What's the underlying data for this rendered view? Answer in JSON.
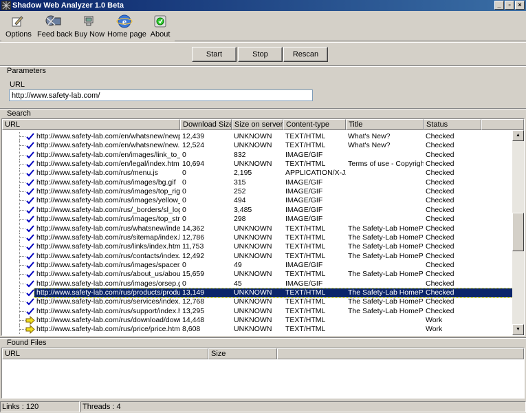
{
  "window": {
    "title": "Shadow Web Analyzer 1.0 Beta"
  },
  "toolbar": {
    "options": "Options",
    "feedback": "Feed back",
    "buynow": "Buy Now",
    "homepage": "Home page",
    "about": "About"
  },
  "actions": {
    "start": "Start",
    "stop": "Stop",
    "rescan": "Rescan"
  },
  "parameters": {
    "group_label": "Parameters",
    "url_label": "URL",
    "url_value": "http://www.safety-lab.com/"
  },
  "search": {
    "group_label": "Search",
    "columns": [
      "URL",
      "Download Size",
      "Size on server",
      "Content-type",
      "Title",
      "Status"
    ],
    "rows": [
      {
        "icon": "check",
        "url": "http://www.safety-lab.com/en/whatsnew/newpres...",
        "dl": "12,439",
        "srv": "UNKNOWN",
        "ct": "TEXT/HTML",
        "title": "What's New?",
        "status": "Checked"
      },
      {
        "icon": "check",
        "url": "http://www.safety-lab.com/en/whatsnew/new.htm",
        "dl": "12,524",
        "srv": "UNKNOWN",
        "ct": "TEXT/HTML",
        "title": "What's New?",
        "status": "Checked"
      },
      {
        "icon": "check",
        "url": "http://www.safety-lab.com/en/images/link_to_top....",
        "dl": "0",
        "srv": "832",
        "ct": "IMAGE/GIF",
        "title": "",
        "status": "Checked"
      },
      {
        "icon": "check",
        "url": "http://www.safety-lab.com/en/legal/index.htm",
        "dl": "10,694",
        "srv": "UNKNOWN",
        "ct": "TEXT/HTML",
        "title": "Terms of use - Copyright - ...",
        "status": "Checked"
      },
      {
        "icon": "check",
        "url": "http://www.safety-lab.com/rus/menu.js",
        "dl": "0",
        "srv": "2,195",
        "ct": "APPLICATION/X-JA...",
        "title": "",
        "status": "Checked"
      },
      {
        "icon": "check",
        "url": "http://www.safety-lab.com/rus/images/bg.gif",
        "dl": "0",
        "srv": "315",
        "ct": "IMAGE/GIF",
        "title": "",
        "status": "Checked"
      },
      {
        "icon": "check",
        "url": "http://www.safety-lab.com/rus/images/top_right_s...",
        "dl": "0",
        "srv": "252",
        "ct": "IMAGE/GIF",
        "title": "",
        "status": "Checked"
      },
      {
        "icon": "check",
        "url": "http://www.safety-lab.com/rus/images/yellow_sep...",
        "dl": "0",
        "srv": "494",
        "ct": "IMAGE/GIF",
        "title": "",
        "status": "Checked"
      },
      {
        "icon": "check",
        "url": "http://www.safety-lab.com/rus/_borders/sl_logo.gif",
        "dl": "0",
        "srv": "3,485",
        "ct": "IMAGE/GIF",
        "title": "",
        "status": "Checked"
      },
      {
        "icon": "check",
        "url": "http://www.safety-lab.com/rus/images/top_stripes....",
        "dl": "0",
        "srv": "298",
        "ct": "IMAGE/GIF",
        "title": "",
        "status": "Checked"
      },
      {
        "icon": "check",
        "url": "http://www.safety-lab.com/rus/whatsnew/index.htm",
        "dl": "14,362",
        "srv": "UNKNOWN",
        "ct": "TEXT/HTML",
        "title": "The Safety-Lab HomePag...",
        "status": "Checked"
      },
      {
        "icon": "check",
        "url": "http://www.safety-lab.com/rus/sitemap/index.htm",
        "dl": "12,786",
        "srv": "UNKNOWN",
        "ct": "TEXT/HTML",
        "title": "The Safety-Lab HomePag...",
        "status": "Checked"
      },
      {
        "icon": "check",
        "url": "http://www.safety-lab.com/rus/links/index.htm",
        "dl": "11,753",
        "srv": "UNKNOWN",
        "ct": "TEXT/HTML",
        "title": "The Safety-Lab HomePag...",
        "status": "Checked"
      },
      {
        "icon": "check",
        "url": "http://www.safety-lab.com/rus/contacts/index.htm",
        "dl": "12,492",
        "srv": "UNKNOWN",
        "ct": "TEXT/HTML",
        "title": "The Safety-Lab HomePag...",
        "status": "Checked"
      },
      {
        "icon": "check",
        "url": "http://www.safety-lab.com/rus/images/spacer.gif",
        "dl": "0",
        "srv": "49",
        "ct": "IMAGE/GIF",
        "title": "",
        "status": "Checked"
      },
      {
        "icon": "check",
        "url": "http://www.safety-lab.com/rus/about_us/about_u...",
        "dl": "15,659",
        "srv": "UNKNOWN",
        "ct": "TEXT/HTML",
        "title": "The Safety-Lab HomePag...",
        "status": "Checked"
      },
      {
        "icon": "check",
        "url": "http://www.safety-lab.com/rus/images/orsep.gif",
        "dl": "0",
        "srv": "45",
        "ct": "IMAGE/GIF",
        "title": "",
        "status": "Checked"
      },
      {
        "icon": "check",
        "url": "http://www.safety-lab.com/rus/products/products....",
        "dl": "13,149",
        "srv": "UNKNOWN",
        "ct": "TEXT/HTML",
        "title": "The Safety-Lab HomePag...",
        "status": "Checked",
        "selected": true
      },
      {
        "icon": "check",
        "url": "http://www.safety-lab.com/rus/services/index.htm",
        "dl": "12,768",
        "srv": "UNKNOWN",
        "ct": "TEXT/HTML",
        "title": "The Safety-Lab HomePag...",
        "status": "Checked"
      },
      {
        "icon": "check",
        "url": "http://www.safety-lab.com/rus/support/index.htm",
        "dl": "13,295",
        "srv": "UNKNOWN",
        "ct": "TEXT/HTML",
        "title": "The Safety-Lab HomePag...",
        "status": "Checked"
      },
      {
        "icon": "arrow",
        "url": "http://www.safety-lab.com/rus/download/downloa...",
        "dl": "14,448",
        "srv": "UNKNOWN",
        "ct": "TEXT/HTML",
        "title": "",
        "status": "Work"
      },
      {
        "icon": "arrow",
        "url": "http://www.safety-lab.com/rus/price/price.htm",
        "dl": "8,608",
        "srv": "UNKNOWN",
        "ct": "TEXT/HTML",
        "title": "",
        "status": "Work"
      }
    ]
  },
  "found_files": {
    "group_label": "Found Files",
    "columns": [
      "URL",
      "Size"
    ]
  },
  "statusbar": {
    "links": "Links : 120",
    "threads": "Threads : 4"
  }
}
